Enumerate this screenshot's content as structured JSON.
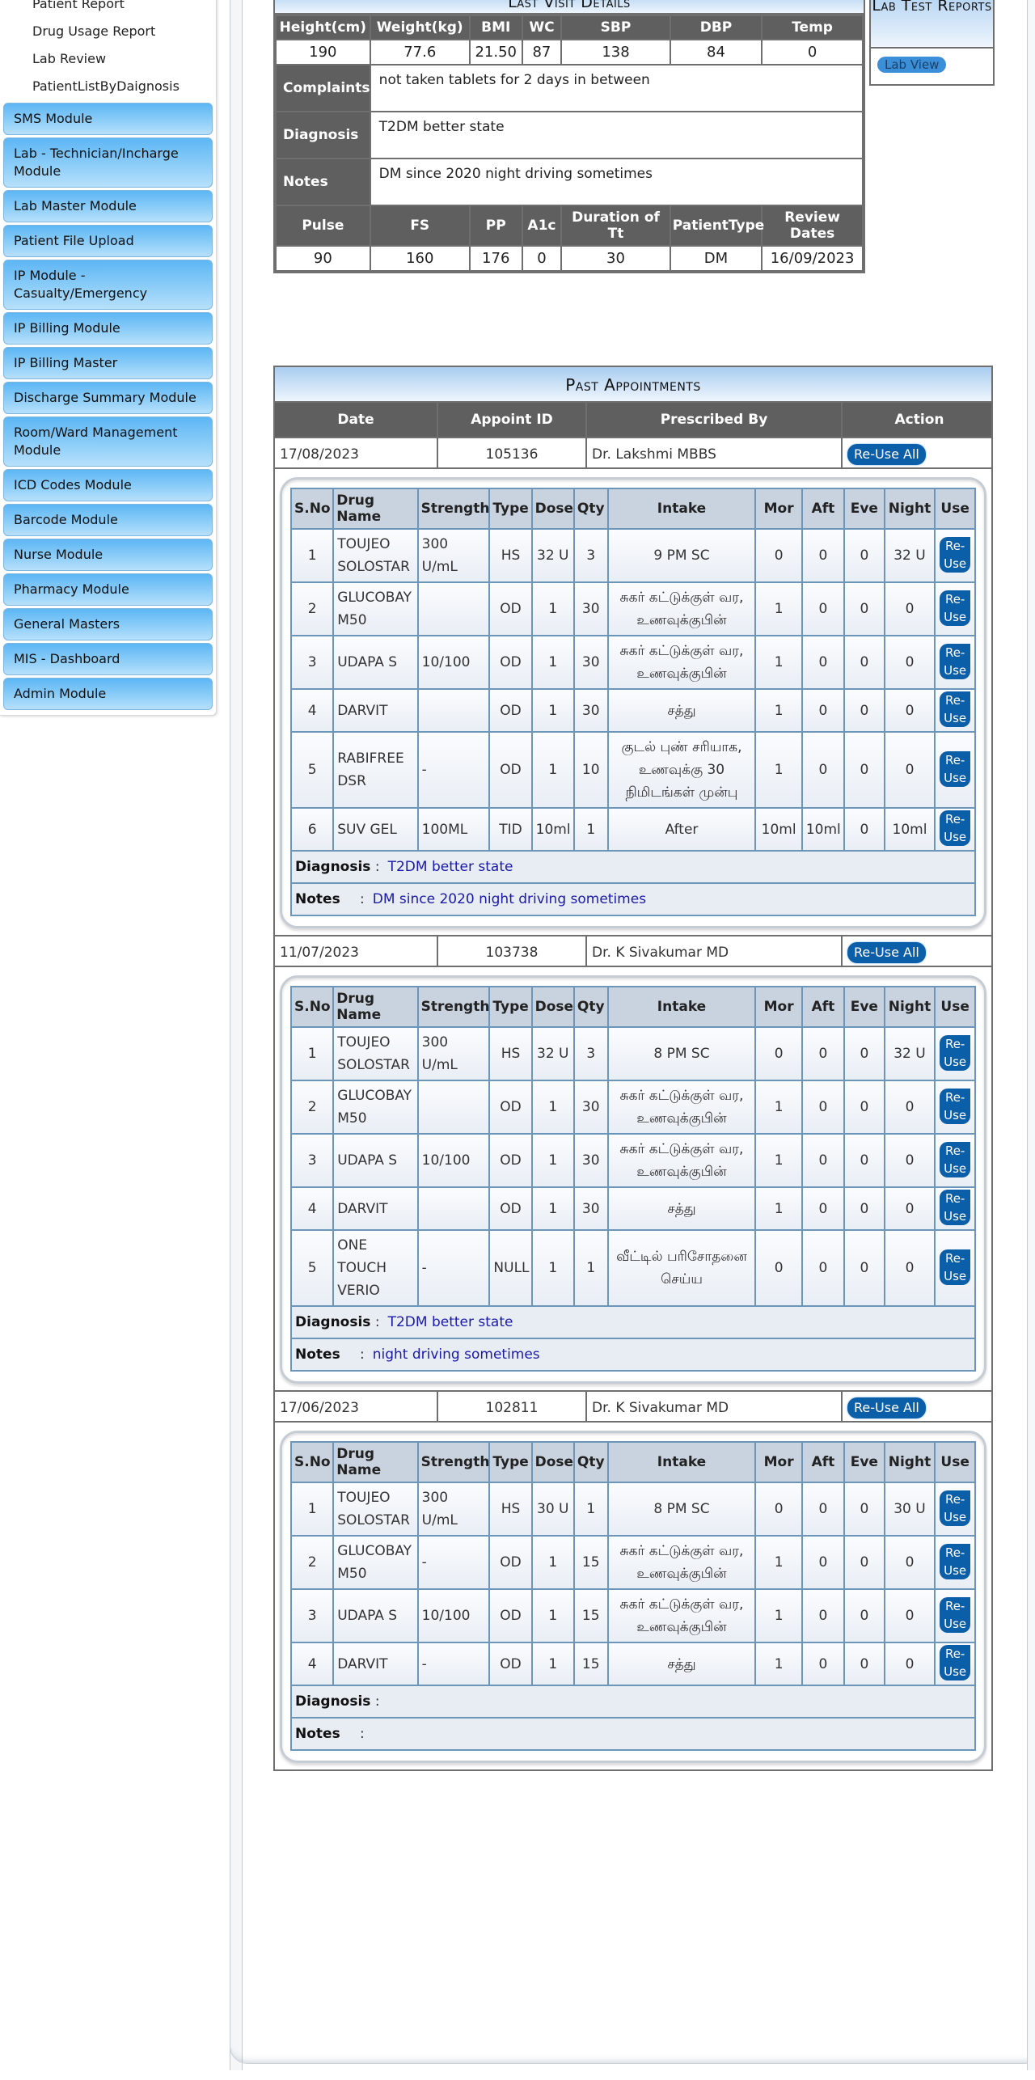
{
  "sidebar": {
    "sub_items": [
      "Patient Report",
      "Drug Usage Report",
      "Lab Review",
      "PatientListByDaignosis"
    ],
    "modules": [
      "SMS Module",
      "Lab - Technician/Incharge Module",
      "Lab Master Module",
      "Patient File Upload",
      "IP Module - Casualty/Emergency",
      "IP Billing Module",
      "IP Billing Master",
      "Discharge Summary Module",
      "Room/Ward Management Module",
      "ICD Codes Module",
      "Barcode Module",
      "Nurse Module",
      "Pharmacy Module",
      "General Masters",
      "MIS - Dashboard",
      "Admin Module"
    ]
  },
  "last_visit": {
    "title": "Last Visit Details",
    "vitals_headers": [
      "Height(cm)",
      "Weight(kg)",
      "BMI",
      "WC",
      "SBP",
      "DBP",
      "Temp"
    ],
    "vitals_values": [
      "190",
      "77.6",
      "21.50",
      "87",
      "138",
      "84",
      "0"
    ],
    "complaints_label": "Complaints",
    "complaints": "not taken tablets for 2 days in between",
    "diagnosis_label": "Diagnosis",
    "diagnosis": "T2DM better state",
    "notes_label": "Notes",
    "notes": "DM since 2020 night driving sometimes",
    "labs_headers": [
      "Pulse",
      "FS",
      "PP",
      "A1c",
      "Duration of Tt",
      "PatientType",
      "Review Dates"
    ],
    "labs_values": [
      "90",
      "160",
      "176",
      "0",
      "30",
      "DM",
      "16/09/2023"
    ]
  },
  "lab_test": {
    "title": "Lab Test Reports",
    "button": "Lab View"
  },
  "past_appointments": {
    "title": "Past Appointments",
    "headers": [
      "Date",
      "Appoint ID",
      "Prescribed By",
      "Action"
    ],
    "reuse_all_label": "Re-Use All",
    "reuse_label": "Re-Use",
    "rx_headers": [
      "S.No",
      "Drug Name",
      "Strength",
      "Type",
      "Dose",
      "Qty",
      "Intake",
      "Mor",
      "Aft",
      "Eve",
      "Night",
      "Use"
    ],
    "diagnosis_label": "Diagnosis",
    "notes_label": "Notes",
    "appointments": [
      {
        "date": "17/08/2023",
        "id": "105136",
        "by": "Dr. Lakshmi MBBS",
        "diagnosis": "T2DM better state",
        "notes": "DM since 2020 night driving sometimes",
        "rows": [
          [
            "1",
            "TOUJEO SOLOSTAR",
            "300 U/mL",
            "HS",
            "32 U",
            "3",
            "9 PM SC",
            "0",
            "0",
            "0",
            "32 U"
          ],
          [
            "2",
            "GLUCOBAY M50",
            "",
            "OD",
            "1",
            "30",
            "சுகர் கட்டுக்குள் வர, உணவுக்குபின்",
            "1",
            "0",
            "0",
            "0"
          ],
          [
            "3",
            "UDAPA S",
            "10/100",
            "OD",
            "1",
            "30",
            "சுகர் கட்டுக்குள் வர, உணவுக்குபின்",
            "1",
            "0",
            "0",
            "0"
          ],
          [
            "4",
            "DARVIT",
            "",
            "OD",
            "1",
            "30",
            "சத்து",
            "1",
            "0",
            "0",
            "0"
          ],
          [
            "5",
            "RABIFREE DSR",
            "-",
            "OD",
            "1",
            "10",
            "குடல் புண் சரியாக, உணவுக்கு 30 நிமிடங்கள் முன்பு",
            "1",
            "0",
            "0",
            "0"
          ],
          [
            "6",
            "SUV GEL",
            "100ML",
            "TID",
            "10ml",
            "1",
            "After",
            "10ml",
            "10ml",
            "0",
            "10ml"
          ]
        ]
      },
      {
        "date": "11/07/2023",
        "id": "103738",
        "by": "Dr. K Sivakumar MD",
        "diagnosis": "T2DM better state",
        "notes": "night driving sometimes",
        "rows": [
          [
            "1",
            "TOUJEO SOLOSTAR",
            "300 U/mL",
            "HS",
            "32 U",
            "3",
            "8 PM SC",
            "0",
            "0",
            "0",
            "32 U"
          ],
          [
            "2",
            "GLUCOBAY M50",
            "",
            "OD",
            "1",
            "30",
            "சுகர் கட்டுக்குள் வர, உணவுக்குபின்",
            "1",
            "0",
            "0",
            "0"
          ],
          [
            "3",
            "UDAPA S",
            "10/100",
            "OD",
            "1",
            "30",
            "சுகர் கட்டுக்குள் வர, உணவுக்குபின்",
            "1",
            "0",
            "0",
            "0"
          ],
          [
            "4",
            "DARVIT",
            "",
            "OD",
            "1",
            "30",
            "சத்து",
            "1",
            "0",
            "0",
            "0"
          ],
          [
            "5",
            "ONE TOUCH VERIO",
            "-",
            "NULL",
            "1",
            "1",
            "வீட்டில் பரிசோதனை செய்ய",
            "0",
            "0",
            "0",
            "0"
          ]
        ]
      },
      {
        "date": "17/06/2023",
        "id": "102811",
        "by": "Dr. K Sivakumar MD",
        "diagnosis": "",
        "notes": "",
        "rows": [
          [
            "1",
            "TOUJEO SOLOSTAR",
            "300 U/mL",
            "HS",
            "30 U",
            "1",
            "8 PM SC",
            "0",
            "0",
            "0",
            "30 U"
          ],
          [
            "2",
            "GLUCOBAY M50",
            "-",
            "OD",
            "1",
            "15",
            "சுகர் கட்டுக்குள் வர, உணவுக்குபின்",
            "1",
            "0",
            "0",
            "0"
          ],
          [
            "3",
            "UDAPA S",
            "10/100",
            "OD",
            "1",
            "15",
            "சுகர் கட்டுக்குள் வர, உணவுக்குபின்",
            "1",
            "0",
            "0",
            "0"
          ],
          [
            "4",
            "DARVIT",
            "-",
            "OD",
            "1",
            "15",
            "சத்து",
            "1",
            "0",
            "0",
            "0"
          ]
        ]
      }
    ]
  }
}
